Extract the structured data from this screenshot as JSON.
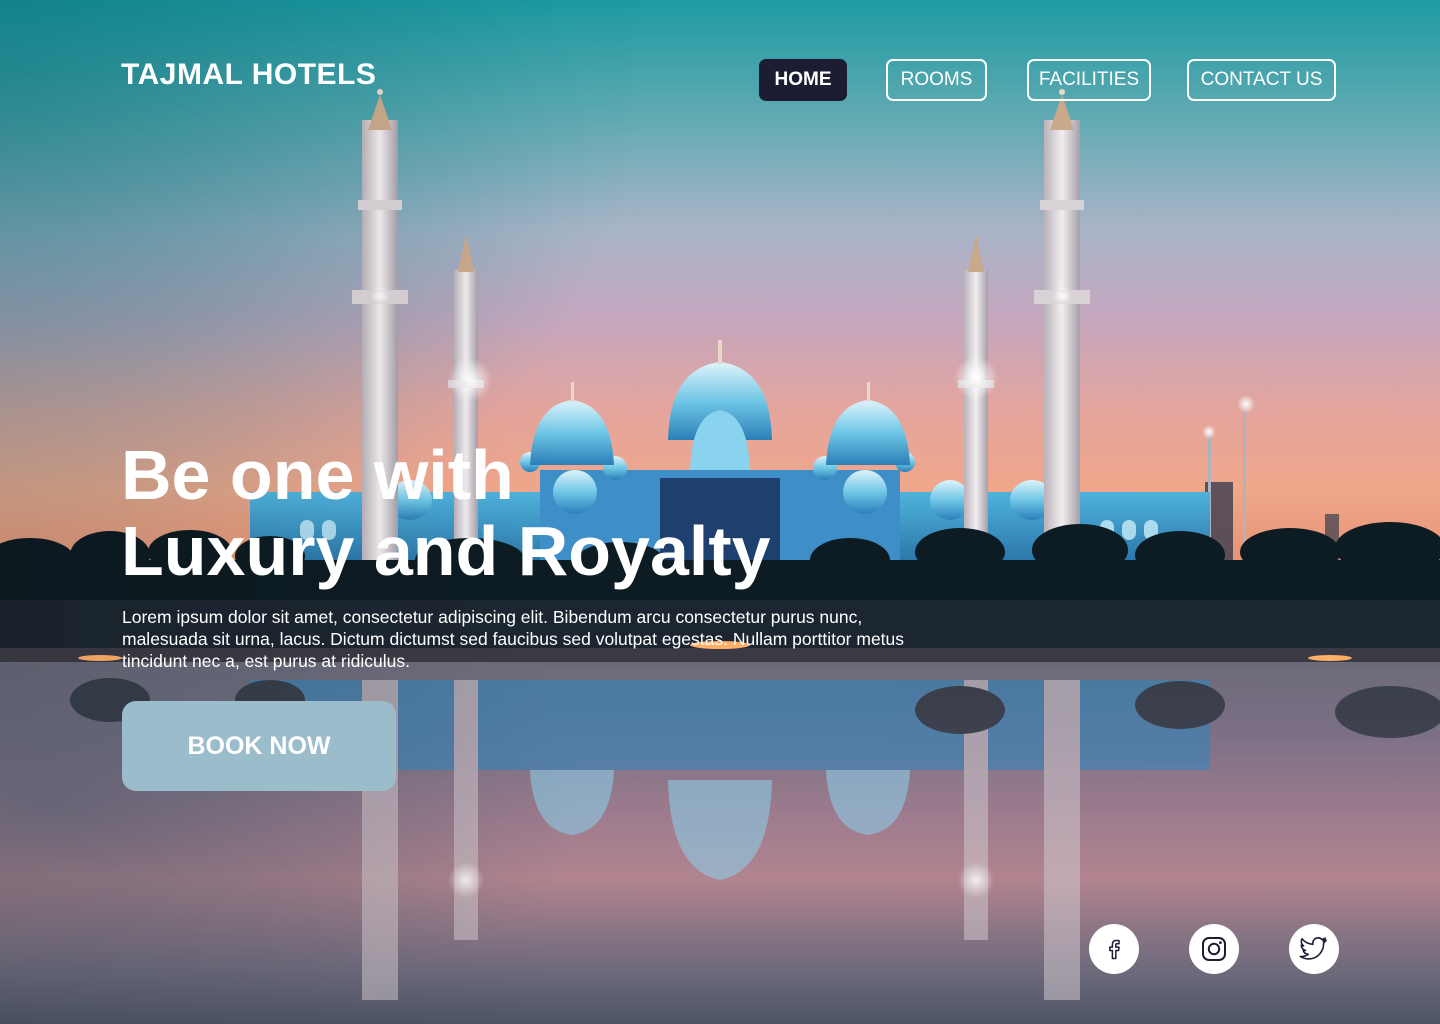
{
  "header": {
    "logo": "TAJMAL HOTELS",
    "nav": {
      "home": "HOME",
      "rooms": "ROOMS",
      "facilities": "FACILITIES",
      "contact": "CONTACT US"
    },
    "active_item": "home"
  },
  "hero": {
    "title_line1": "Be one with",
    "title_line2": "Luxury and Royalty",
    "description": "Lorem ipsum dolor sit amet, consectetur adipiscing elit. Bibendum arcu consectetur purus nunc, malesuada sit urna, lacus. Dictum dictumst sed faucibus sed volutpat egestas. Nullam porttitor metus tincidunt nec a, est purus at ridiculus.",
    "cta_label": "BOOK NOW"
  },
  "social": {
    "icons": [
      "facebook-icon",
      "instagram-icon",
      "twitter-icon"
    ]
  },
  "colors": {
    "active_nav_bg": "#1c1d33",
    "cta_bg": "#9bbccb",
    "text": "#ffffff"
  }
}
